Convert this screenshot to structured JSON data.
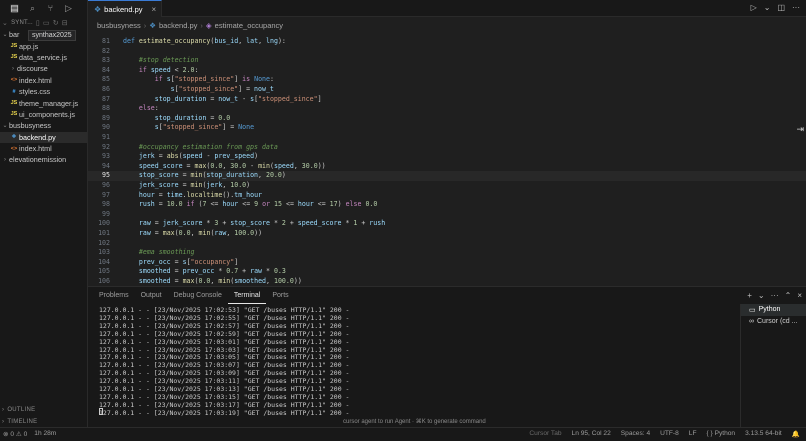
{
  "activity_bar": {
    "icons": [
      "files-icon",
      "search-icon",
      "source-control-icon",
      "run-debug-icon"
    ]
  },
  "explorer": {
    "workspace_label": "SYNT...",
    "tooltip": "synthax2025",
    "items": [
      {
        "label": "bar",
        "type": "folder",
        "indent": 0,
        "expanded": true
      },
      {
        "label": "app.js",
        "type": "js",
        "indent": 1
      },
      {
        "label": "data_service.js",
        "type": "js",
        "indent": 1
      },
      {
        "label": "discourse",
        "type": "folder-closed",
        "indent": 1
      },
      {
        "label": "index.html",
        "type": "html",
        "indent": 1
      },
      {
        "label": "styles.css",
        "type": "css",
        "indent": 1
      },
      {
        "label": "theme_manager.js",
        "type": "js",
        "indent": 1
      },
      {
        "label": "ui_components.js",
        "type": "js",
        "indent": 1
      },
      {
        "label": "busbusyness",
        "type": "folder",
        "indent": 0,
        "expanded": true
      },
      {
        "label": "backend.py",
        "type": "py",
        "indent": 1,
        "selected": true
      },
      {
        "label": "index.html",
        "type": "html",
        "indent": 1
      },
      {
        "label": "elevationemission",
        "type": "folder-closed",
        "indent": 0
      }
    ],
    "outline_label": "OUTLINE",
    "timeline_label": "TIMELINE"
  },
  "editor": {
    "tab_label": "backend.py",
    "breadcrumb": [
      "busbusyness",
      "backend.py",
      "estimate_occupancy"
    ],
    "lines": [
      {
        "n": "81",
        "text": "def estimate_occupancy(bus_id, lat, lng):"
      },
      {
        "n": "82",
        "text": ""
      },
      {
        "n": "83",
        "text": "    #stop detection"
      },
      {
        "n": "84",
        "text": "    if speed < 2.0:"
      },
      {
        "n": "85",
        "text": "        if s[\"stopped_since\"] is None:"
      },
      {
        "n": "86",
        "text": "            s[\"stopped_since\"] = now_t"
      },
      {
        "n": "87",
        "text": "        stop_duration = now_t - s[\"stopped_since\"]"
      },
      {
        "n": "88",
        "text": "    else:"
      },
      {
        "n": "89",
        "text": "        stop_duration = 0.0"
      },
      {
        "n": "90",
        "text": "        s[\"stopped_since\"] = None"
      },
      {
        "n": "91",
        "text": ""
      },
      {
        "n": "92",
        "text": "    #occupancy estimation from gps data"
      },
      {
        "n": "93",
        "text": "    jerk = abs(speed - prev_speed)"
      },
      {
        "n": "94",
        "text": "    speed_score = max(0.0, 30.0 - min(speed, 30.0))"
      },
      {
        "n": "95",
        "text": "    stop_score = min(stop_duration, 20.0)"
      },
      {
        "n": "96",
        "text": "    jerk_score = min(jerk, 10.0)"
      },
      {
        "n": "97",
        "text": "    hour = time.localtime().tm_hour"
      },
      {
        "n": "98",
        "text": "    rush = 10.0 if (7 <= hour <= 9 or 15 <= hour <= 17) else 0.0"
      },
      {
        "n": "99",
        "text": ""
      },
      {
        "n": "100",
        "text": "    raw = jerk_score * 3 + stop_score * 2 + speed_score * 1 + rush"
      },
      {
        "n": "101",
        "text": "    raw = max(0.0, min(raw, 100.0))"
      },
      {
        "n": "102",
        "text": ""
      },
      {
        "n": "103",
        "text": "    #ema smoothing"
      },
      {
        "n": "104",
        "text": "    prev_occ = s[\"occupancy\"]"
      },
      {
        "n": "105",
        "text": "    smoothed = prev_occ * 0.7 + raw * 0.3"
      },
      {
        "n": "106",
        "text": "    smoothed = max(0.0, min(smoothed, 100.0))"
      }
    ],
    "current_line": "95"
  },
  "panel": {
    "tabs": [
      "Problems",
      "Output",
      "Debug Console",
      "Terminal",
      "Ports"
    ],
    "active_tab": "Terminal",
    "terminal_lines": [
      "127.0.0.1 - - [23/Nov/2025 17:02:53] \"GET /buses HTTP/1.1\" 200 -",
      "127.0.0.1 - - [23/Nov/2025 17:02:55] \"GET /buses HTTP/1.1\" 200 -",
      "127.0.0.1 - - [23/Nov/2025 17:02:57] \"GET /buses HTTP/1.1\" 200 -",
      "127.0.0.1 - - [23/Nov/2025 17:02:59] \"GET /buses HTTP/1.1\" 200 -",
      "127.0.0.1 - - [23/Nov/2025 17:03:01] \"GET /buses HTTP/1.1\" 200 -",
      "127.0.0.1 - - [23/Nov/2025 17:03:03] \"GET /buses HTTP/1.1\" 200 -",
      "127.0.0.1 - - [23/Nov/2025 17:03:05] \"GET /buses HTTP/1.1\" 200 -",
      "127.0.0.1 - - [23/Nov/2025 17:03:07] \"GET /buses HTTP/1.1\" 200 -",
      "127.0.0.1 - - [23/Nov/2025 17:03:09] \"GET /buses HTTP/1.1\" 200 -",
      "127.0.0.1 - - [23/Nov/2025 17:03:11] \"GET /buses HTTP/1.1\" 200 -",
      "127.0.0.1 - - [23/Nov/2025 17:03:13] \"GET /buses HTTP/1.1\" 200 -",
      "127.0.0.1 - - [23/Nov/2025 17:03:15] \"GET /buses HTTP/1.1\" 200 -",
      "127.0.0.1 - - [23/Nov/2025 17:03:17] \"GET /buses HTTP/1.1\" 200 -",
      "127.0.0.1 - - [23/Nov/2025 17:03:19] \"GET /buses HTTP/1.1\" 200 -"
    ],
    "terminal_hint": "cursor agent to run Agent · ⌘K to generate command",
    "terminal_instances": [
      "Python",
      "Cursor (cd ..."
    ]
  },
  "statusbar": {
    "left": [
      "⊗ 0 ⚠ 0",
      "1h 28m"
    ],
    "right": [
      "Cursor Tab",
      "Ln 95, Col 22",
      "Spaces: 4",
      "UTF-8",
      "LF",
      "{ } Python",
      "3.13.5 64-bit",
      "🔔"
    ]
  }
}
